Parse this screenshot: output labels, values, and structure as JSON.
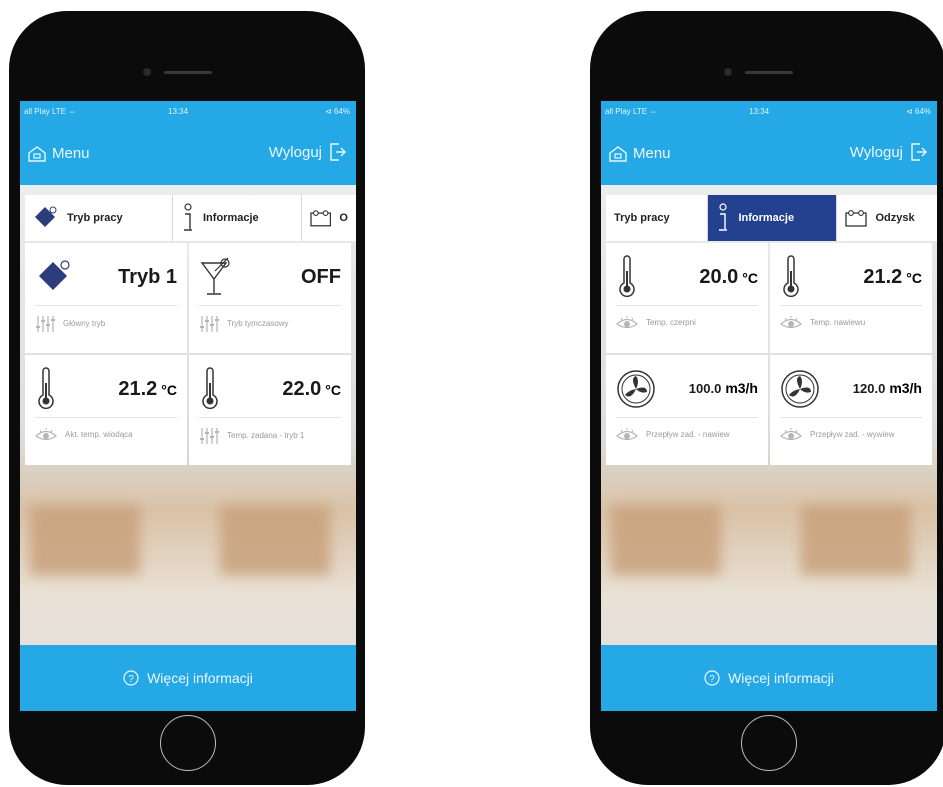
{
  "left": {
    "status": {
      "carrier": "all Play LTE ⇔",
      "time": "13:34",
      "battery": "⊲ 64%"
    },
    "nav": {
      "menu": "Menu",
      "logout": "Wyloguj"
    },
    "tabs": [
      {
        "label": "Tryb pracy",
        "icon": "mode-diamond-icon"
      },
      {
        "label": "Informacje",
        "icon": "info-icon"
      },
      {
        "label": "O",
        "icon": "recovery-icon"
      }
    ],
    "tiles": [
      {
        "value": "Tryb 1",
        "unit": "",
        "label": "Główny tryb"
      },
      {
        "value": "OFF",
        "unit": "",
        "label": "Tryb tymczasowy"
      },
      {
        "value": "21.2",
        "unit": "°C",
        "label": "Akt. temp. wiodąca"
      },
      {
        "value": "22.0",
        "unit": "°C",
        "label": "Temp. zadana - tryb 1"
      }
    ],
    "footer": "Więcej informacji"
  },
  "right": {
    "status": {
      "carrier": "all Play LTE ⇔",
      "time": "13:34",
      "battery": "⊲ 64%"
    },
    "nav": {
      "menu": "Menu",
      "logout": "Wyloguj"
    },
    "tabs": [
      {
        "label": "Tryb pracy",
        "icon": ""
      },
      {
        "label": "Informacje",
        "icon": "info-icon"
      },
      {
        "label": "Odzysk",
        "icon": "recovery-icon"
      }
    ],
    "tiles": [
      {
        "value": "20.0",
        "unit": "°C",
        "label": "Temp. czerpni"
      },
      {
        "value": "21.2",
        "unit": "°C",
        "label": "Temp. nawiewu"
      },
      {
        "value": "100.0",
        "unit": "m3/h",
        "label": "Przepływ zad. - nawiew"
      },
      {
        "value": "120.0",
        "unit": "m3/h",
        "label": "Przepływ zad. - wywiew"
      }
    ],
    "footer": "Więcej informacji"
  },
  "colors": {
    "primary_blue": "#24a9e6",
    "active_tab": "#23418f",
    "icon_navy": "#2b3d7a"
  }
}
